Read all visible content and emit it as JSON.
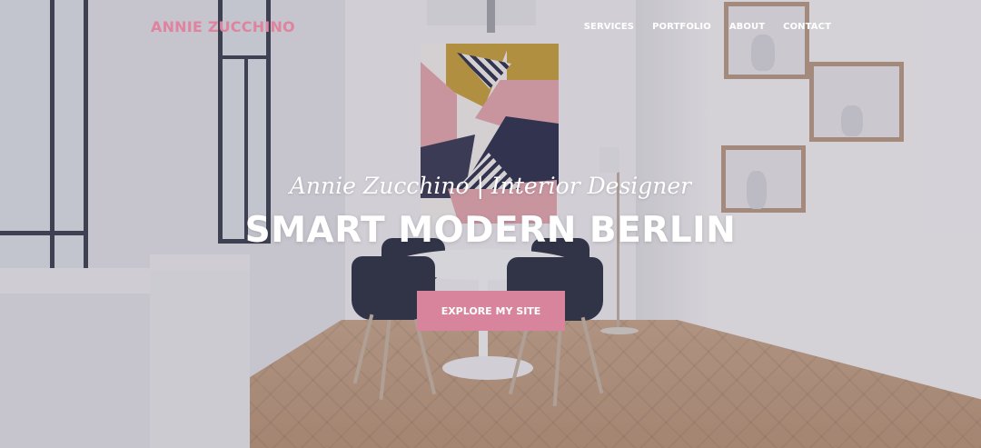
{
  "brand": {
    "logo_text": "ANNIE ZUCCHINO",
    "accent_color": "#d8849c"
  },
  "nav": {
    "items": [
      {
        "label": "SERVICES"
      },
      {
        "label": "PORTFOLIO"
      },
      {
        "label": "ABOUT"
      },
      {
        "label": "CONTACT"
      }
    ]
  },
  "hero": {
    "subtitle": "Annie Zucchino | Interior Designer",
    "title": "SMART MODERN BERLIN",
    "cta_label": "EXPLORE MY SITE"
  }
}
